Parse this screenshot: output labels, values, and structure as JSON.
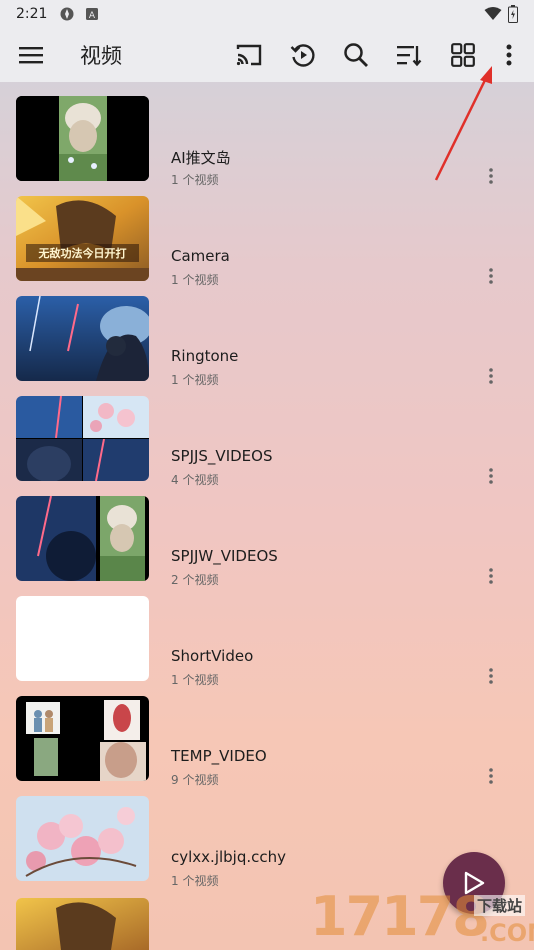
{
  "status": {
    "time": "2:21"
  },
  "toolbar": {
    "title": "视频",
    "icons": [
      "menu-icon",
      "cast-icon",
      "history-icon",
      "search-icon",
      "sort-icon",
      "grid-icon",
      "more-vert-icon"
    ]
  },
  "folders": [
    {
      "name": "AI推文岛",
      "count": "1 个视频"
    },
    {
      "name": "Camera",
      "count": "1 个视频",
      "thumb_text": "无敌功法今日开打"
    },
    {
      "name": "Ringtone",
      "count": "1 个视频"
    },
    {
      "name": "SPJJS_VIDEOS",
      "count": "4 个视频"
    },
    {
      "name": "SPJJW_VIDEOS",
      "count": "2 个视频"
    },
    {
      "name": "ShortVideo",
      "count": "1 个视频"
    },
    {
      "name": "TEMP_VIDEO",
      "count": "9 个视频"
    },
    {
      "name": "cylxx.jlbjq.cchy",
      "count": "1 个视频"
    }
  ],
  "watermark": {
    "number": "17178",
    "text": "下载站",
    "suffix": ".COM"
  },
  "colors": {
    "fab": "#6a2e4b",
    "arrow": "#e0302a"
  }
}
